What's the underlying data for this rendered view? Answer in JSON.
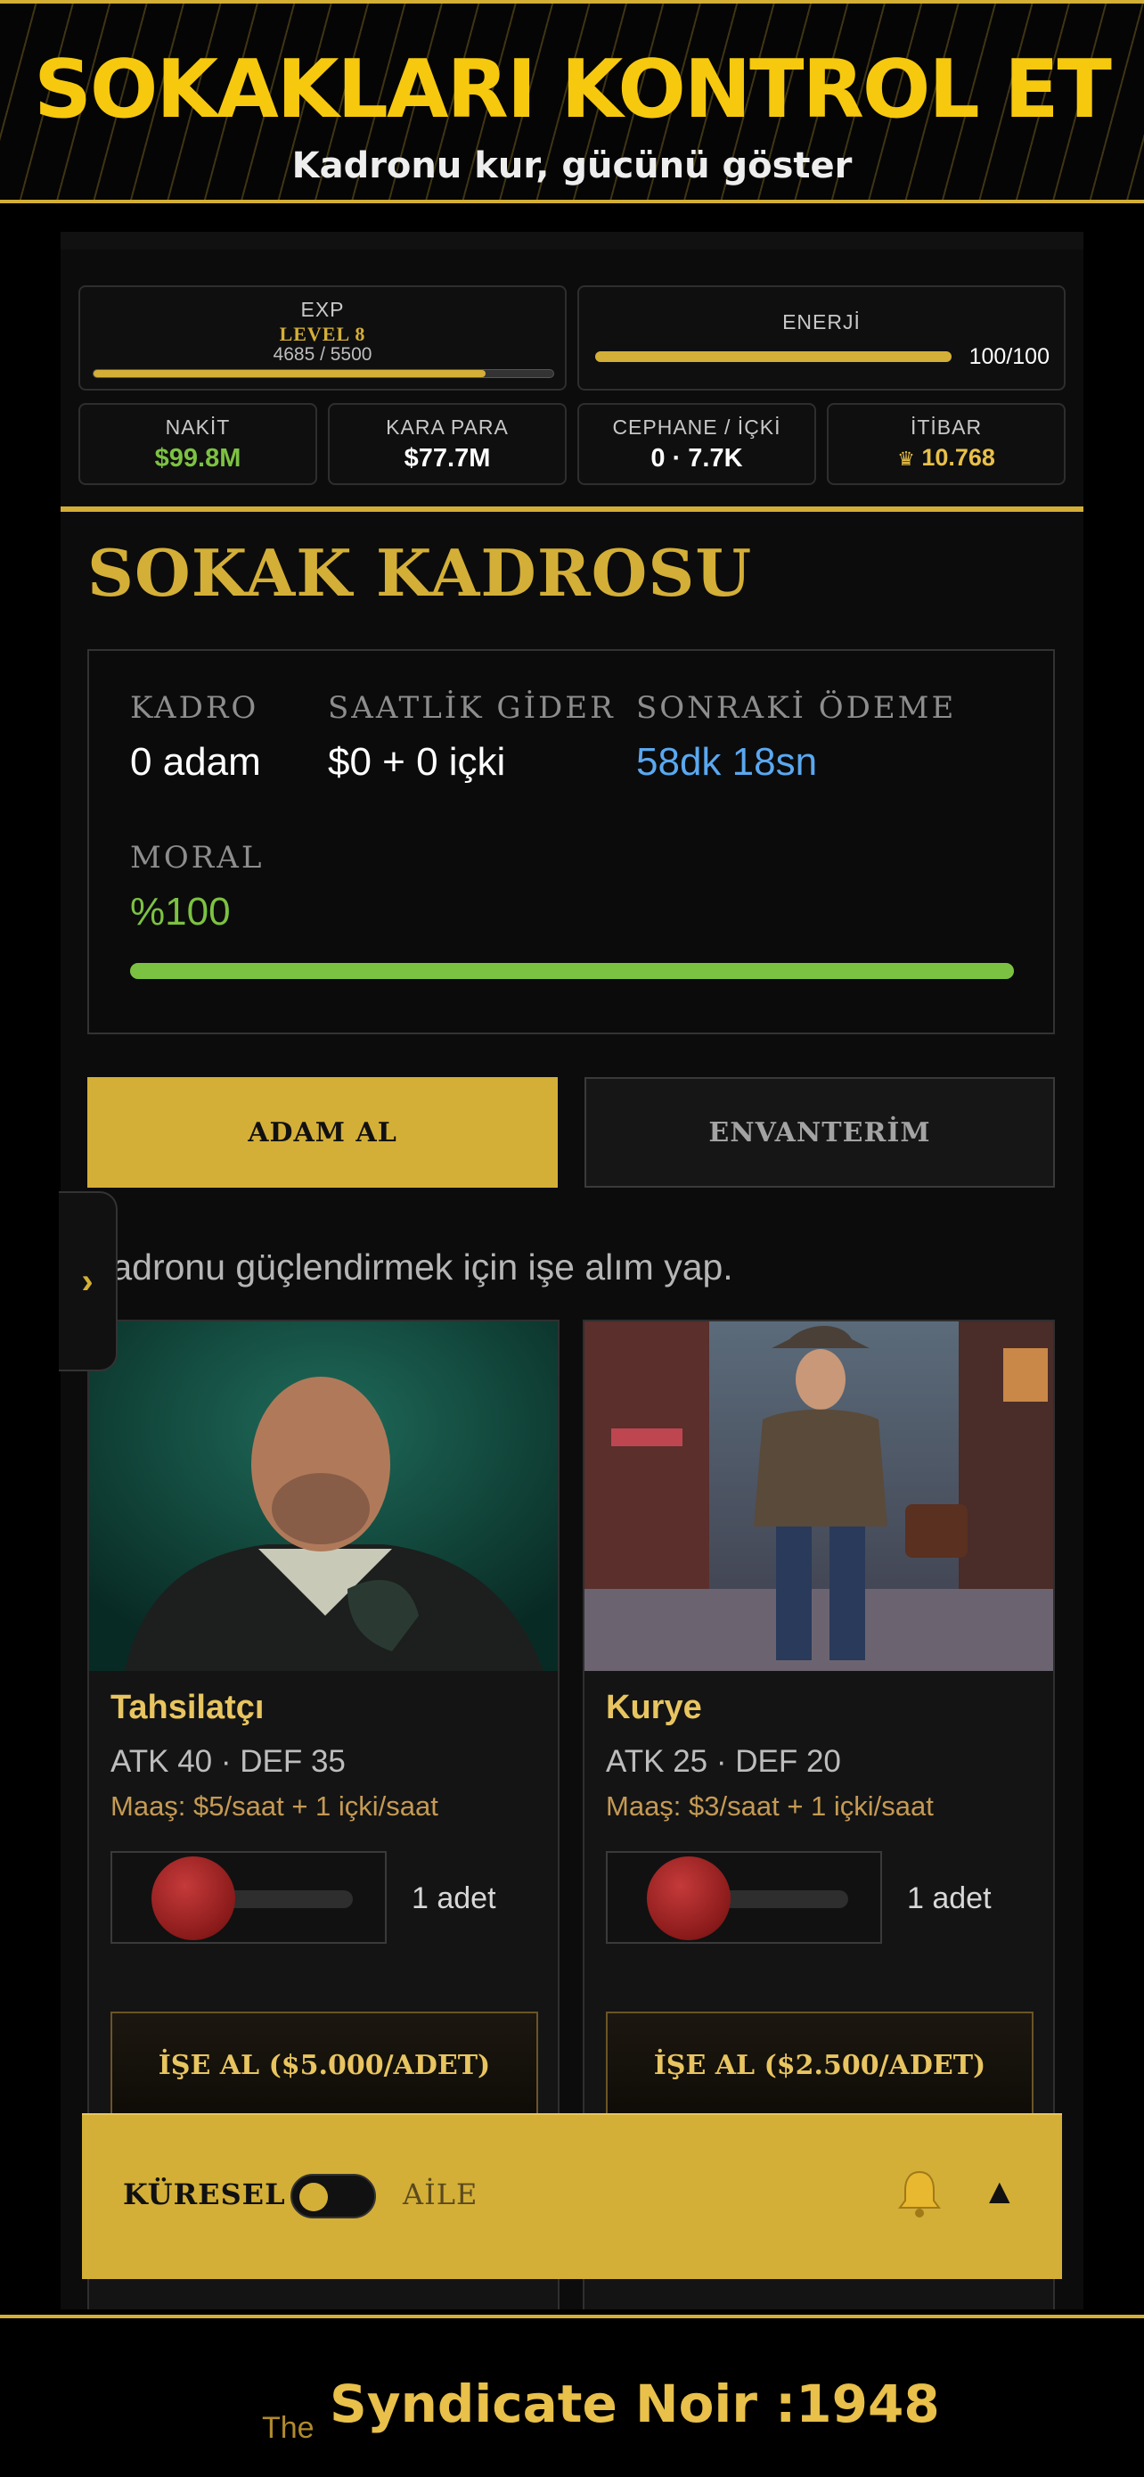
{
  "banner": {
    "title": "SOKAKLARI KONTROL ET",
    "subtitle": "Kadronu kur, gücünü göster"
  },
  "stats": {
    "exp": {
      "label": "EXP",
      "level": "LEVEL 8",
      "progress_text": "4685 / 5500",
      "progress": 0.852
    },
    "energy": {
      "label": "ENERJİ",
      "value": "100/100",
      "progress": 1.0
    },
    "cash": {
      "label": "NAKİT",
      "value": "$99.8M"
    },
    "black_money": {
      "label": "KARA PARA",
      "value": "$77.7M"
    },
    "ammo": {
      "label": "CEPHANE / İÇKİ",
      "value": "0 · 7.7K"
    },
    "reputation": {
      "label": "İTİBAR",
      "value": "10.768"
    }
  },
  "section": {
    "title": "SOKAK KADROSU",
    "roster_label": "KADRO",
    "roster_value": "0 adam",
    "cost_label": "SAATLİK GİDER",
    "cost_value": "$0 + 0 içki",
    "next_label": "SONRAKİ ÖDEME",
    "next_value": "58dk 18sn",
    "morale_label": "MORAL",
    "morale_value": "%100",
    "morale_progress": 1.0
  },
  "tabs": {
    "hire": "ADAM AL",
    "inventory": "ENVANTERİM"
  },
  "hint": "Kadronu güçlendirmek için işe alım yap.",
  "side_tab": "›",
  "cards": [
    {
      "name": "Tahsilatçı",
      "stats": "ATK 40 · DEF 35",
      "wage": "Maaş: $5/saat + 1 içki/saat",
      "quantity": "1 adet",
      "hire_label": "İŞE AL ($5.000/ADET)"
    },
    {
      "name": "Kurye",
      "stats": "ATK 25 · DEF 20",
      "wage": "Maaş: $3/saat + 1 içki/saat",
      "quantity": "1 adet",
      "hire_label": "İŞE AL ($2.500/ADET)"
    }
  ],
  "chat": {
    "global": "KÜRESEL",
    "family": "AİLE",
    "arrow": "▲"
  },
  "footer": {
    "prefix": "The",
    "title": "Syndicate Noir :1948"
  },
  "colors": {
    "gold": "#d4af37",
    "cash_green": "#7cc242",
    "timer_blue": "#5aa8f0",
    "background": "#000000"
  },
  "icons": {
    "reputation": "crown-icon",
    "notifications": "bell-icon",
    "chat_toggle": "arrow-up-icon",
    "side_panel": "chevron-right-icon"
  }
}
